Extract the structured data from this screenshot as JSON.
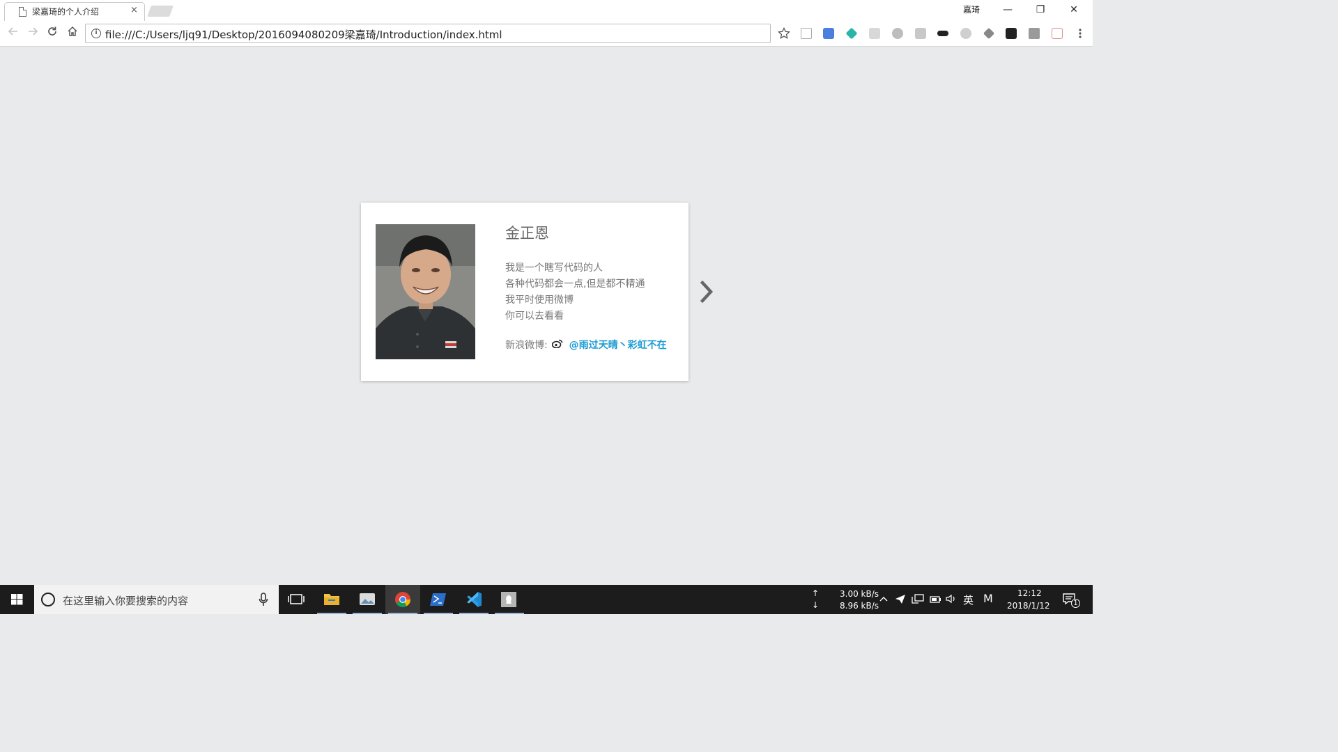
{
  "browser": {
    "tab_title": "梁嘉琦的个人介绍",
    "tab_close": "×",
    "user_name": "嘉琦",
    "url": "file:///C:/Users/ljq91/Desktop/2016094080209梁嘉琦/Introduction/index.html",
    "window_controls": {
      "minimize": "—",
      "restore": "❐",
      "close": "✕"
    }
  },
  "profile": {
    "name": "金正恩",
    "bio_lines": [
      "我是一个瞎写代码的人",
      "各种代码都会一点,但是都不精通",
      "我平时使用微博",
      "你可以去看看"
    ],
    "weibo_label": "新浪微博:",
    "weibo_handle": "@雨过天晴丶彩虹不在",
    "link_color": "#1a9bd1"
  },
  "taskbar": {
    "search_placeholder": "在这里输入你要搜索的内容",
    "upload_arrow": "↑",
    "download_arrow": "↓",
    "upload_speed": "3.00 kB/s",
    "download_speed": "8.96 kB/s",
    "ime_lang": "英",
    "ime_mode": "M",
    "time": "12:12",
    "date": "2018/1/12",
    "notification_count": "1"
  }
}
